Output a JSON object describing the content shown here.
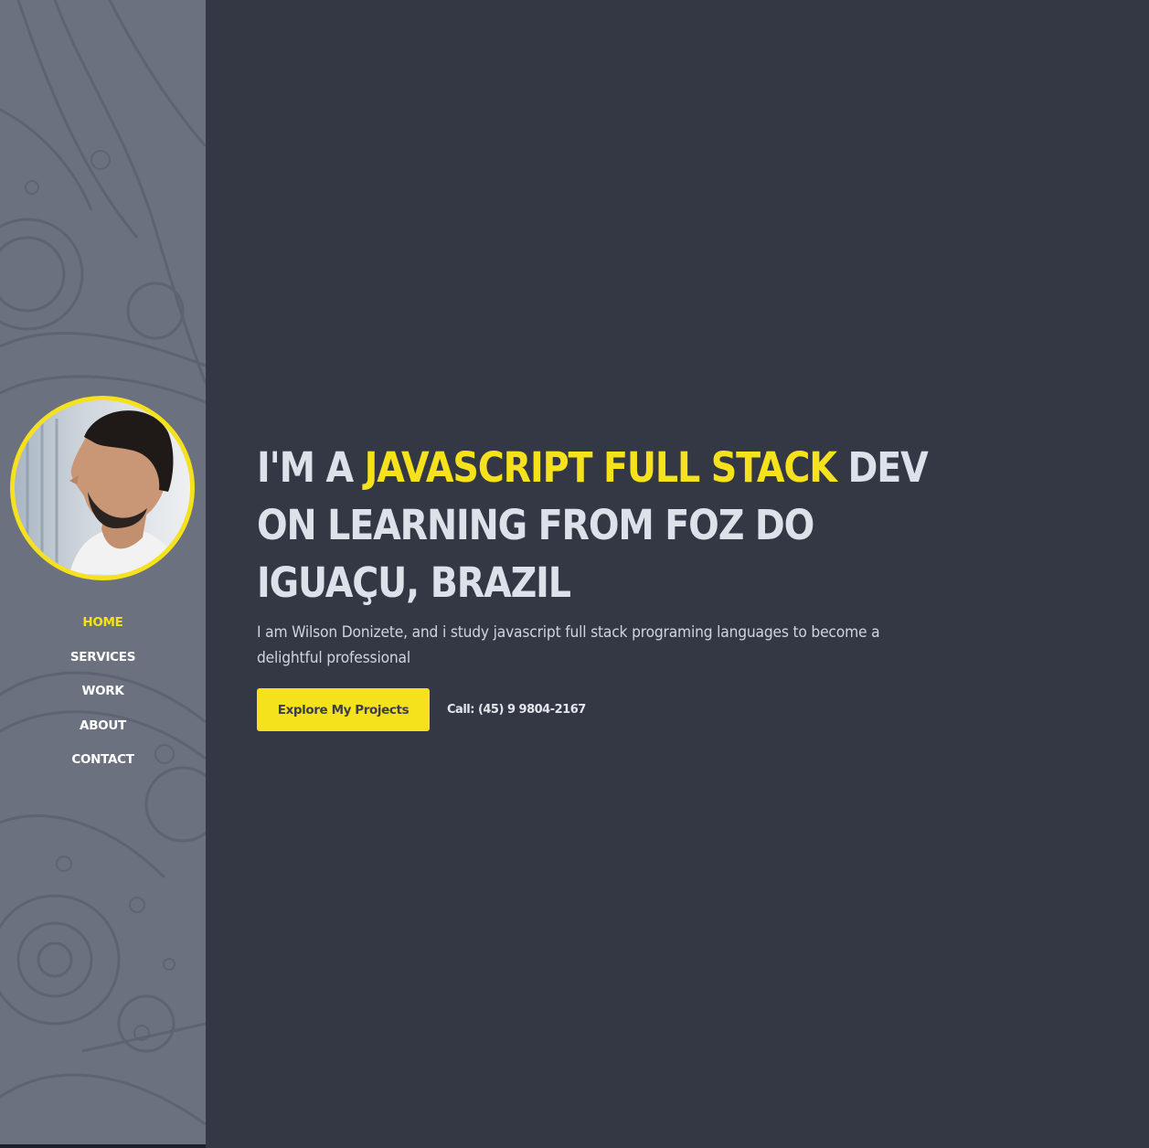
{
  "nav": {
    "items": [
      {
        "label": "HOME",
        "active": true
      },
      {
        "label": "SERVICES",
        "active": false
      },
      {
        "label": "WORK",
        "active": false
      },
      {
        "label": "ABOUT",
        "active": false
      },
      {
        "label": "CONTACT",
        "active": false
      }
    ]
  },
  "hero": {
    "headline_prefix": "I'M A ",
    "headline_highlight": "JAVASCRIPT FULL STACK",
    "headline_suffix": " DEV ON LEARNING FROM FOZ DO IGUAÇU, BRAZIL",
    "intro": "I am Wilson Donizete, and i study javascript full stack programing languages to become a delightful professional",
    "cta_label": "Explore My Projects",
    "call_text": "Call: (45) 9 9804-2167"
  },
  "colors": {
    "accent": "#f5e11c",
    "background": "#343845",
    "sidebar": "#6b717f",
    "text": "#dde1ea"
  },
  "icons": {
    "avatar": "profile-photo"
  }
}
